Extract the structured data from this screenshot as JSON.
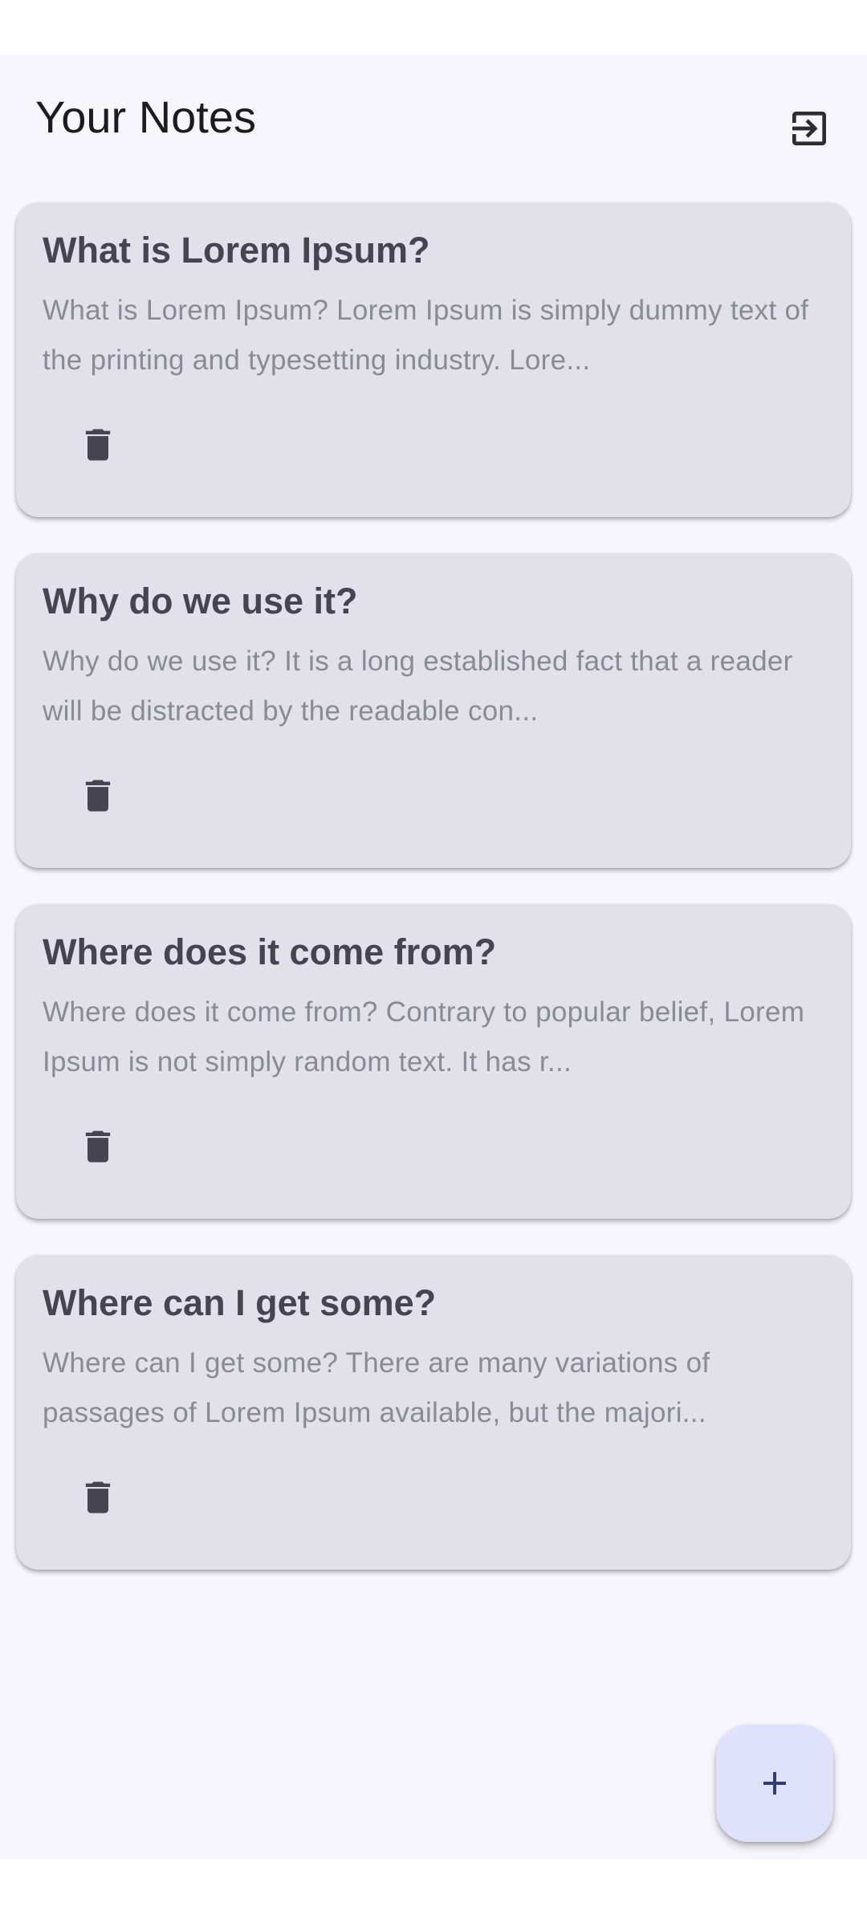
{
  "header": {
    "title": "Your Notes",
    "logout_icon": "logout-icon"
  },
  "notes": [
    {
      "title": "What is Lorem Ipsum?",
      "preview": "What is Lorem Ipsum? Lorem Ipsum is simply dummy text of the printing and typesetting industry. Lore...",
      "delete_icon": "trash-icon"
    },
    {
      "title": "Why do we use it?",
      "preview": "Why do we use it? It is a long established fact that a reader will be distracted by the readable con...",
      "delete_icon": "trash-icon"
    },
    {
      "title": "Where does it come from?",
      "preview": "Where does it come from? Contrary to popular belief, Lorem Ipsum is not simply random text. It has r...",
      "delete_icon": "trash-icon"
    },
    {
      "title": "Where can I get some?",
      "preview": "Where can I get some? There are many variations of passages of Lorem Ipsum available, but the majori...",
      "delete_icon": "trash-icon"
    }
  ],
  "fab": {
    "icon": "plus-icon"
  },
  "colors": {
    "background": "#f7f6fc",
    "card": "#e2e1ea",
    "title_text": "#45444f",
    "body_text": "#8a8a92",
    "fab": "#dfe2fa",
    "fab_icon": "#2f3f73"
  }
}
